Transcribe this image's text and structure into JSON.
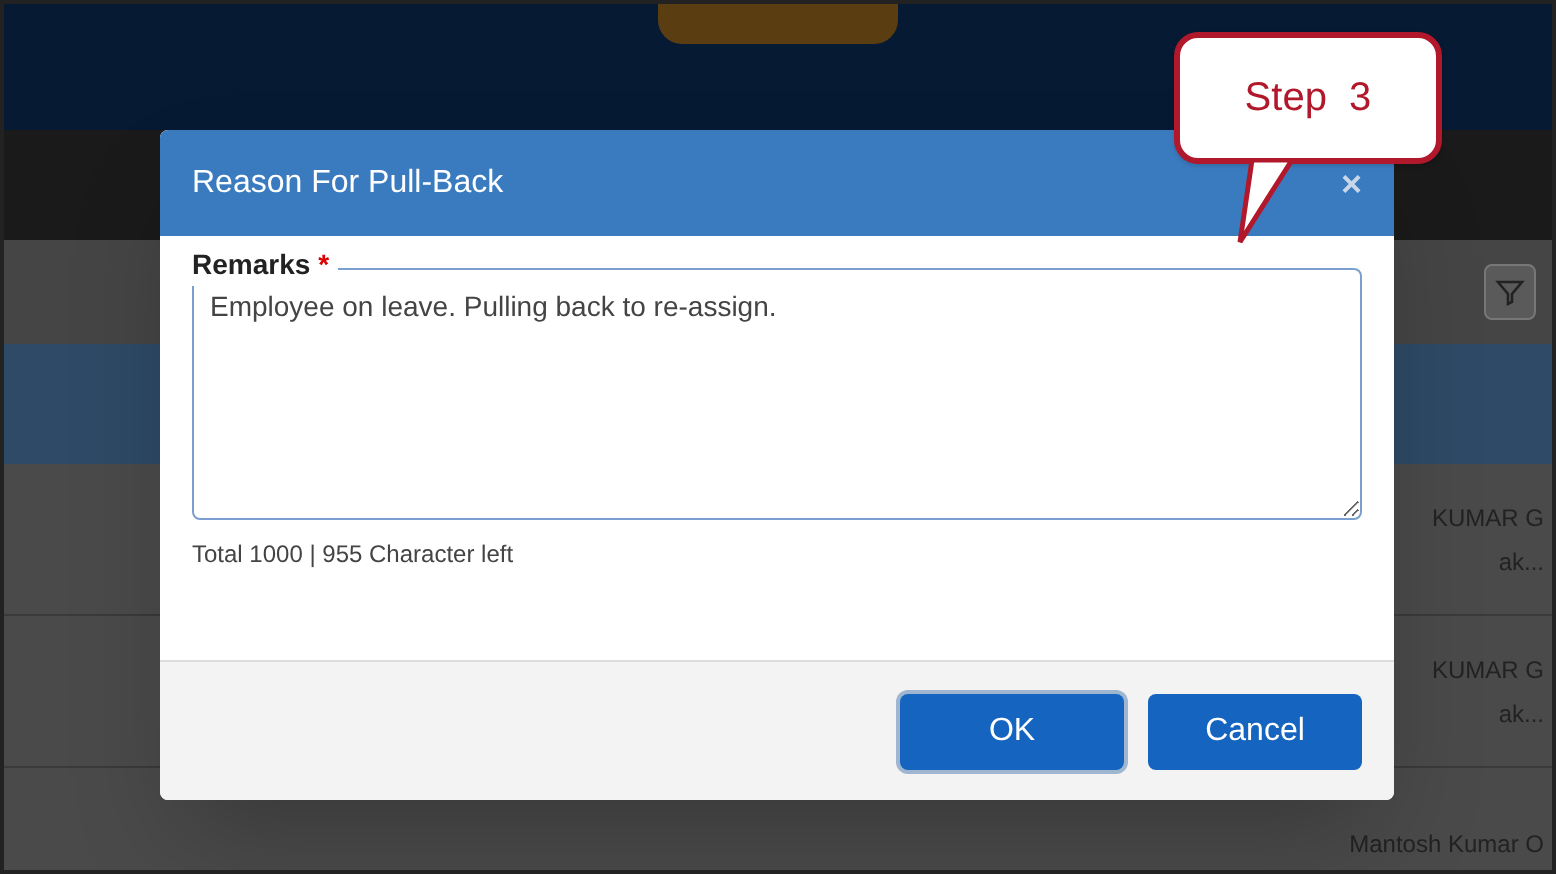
{
  "background_rows": [
    {
      "name": "KUMAR G",
      "sub": "ak..."
    },
    {
      "name": "KUMAR G",
      "sub": "ak..."
    },
    {
      "name": "Mantosh Kumar O"
    }
  ],
  "dialog": {
    "title": "Reason For Pull-Back",
    "close": "×",
    "field": {
      "label": "Remarks",
      "required": true,
      "required_mark": "*",
      "value": "Employee on leave. Pulling back to re-assign."
    },
    "counter": "Total 1000 | 955 Character left",
    "buttons": [
      {
        "label": "OK",
        "focused": true
      },
      {
        "label": "Cancel",
        "focused": false
      }
    ]
  },
  "callout": {
    "text": "Step  3"
  }
}
